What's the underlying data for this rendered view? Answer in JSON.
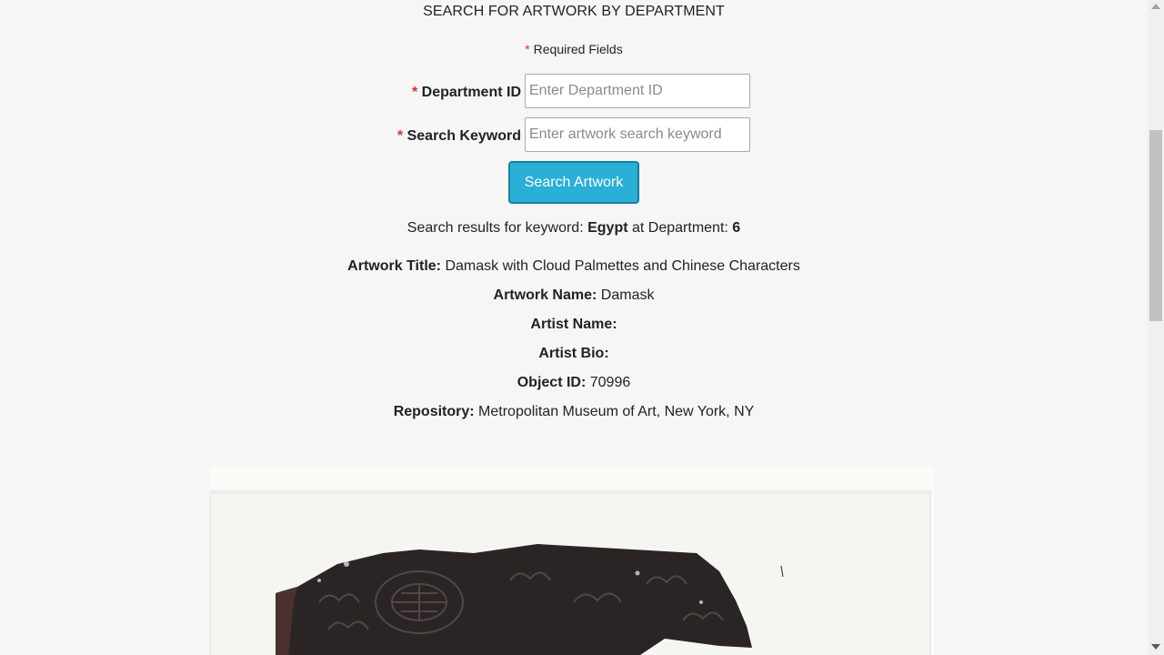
{
  "header": {
    "title": "SEARCH FOR ARTWORK BY DEPARTMENT"
  },
  "form": {
    "required_star": "*",
    "required_note": "Required Fields",
    "department": {
      "label": "Department ID",
      "value": "",
      "placeholder": "Enter Department ID"
    },
    "keyword": {
      "label": "Search Keyword",
      "value": "",
      "placeholder": "Enter artwork search keyword"
    },
    "submit_label": "Search Artwork"
  },
  "results": {
    "prefix": "Search results for keyword:",
    "keyword": "Egypt",
    "middle": "at Department:",
    "department": "6"
  },
  "artwork": {
    "title_label": "Artwork Title:",
    "title": "Damask with Cloud Palmettes and Chinese Characters",
    "name_label": "Artwork Name:",
    "name": "Damask",
    "artist_label": "Artist Name:",
    "artist": "",
    "bio_label": "Artist Bio:",
    "bio": "",
    "object_id_label": "Object ID:",
    "object_id": "70996",
    "repository_label": "Repository:",
    "repository": "Metropolitan Museum of Art, New York, NY"
  },
  "colors": {
    "accent": "#2aafd6",
    "required": "#e32b2b",
    "background": "#f6f6f6"
  }
}
